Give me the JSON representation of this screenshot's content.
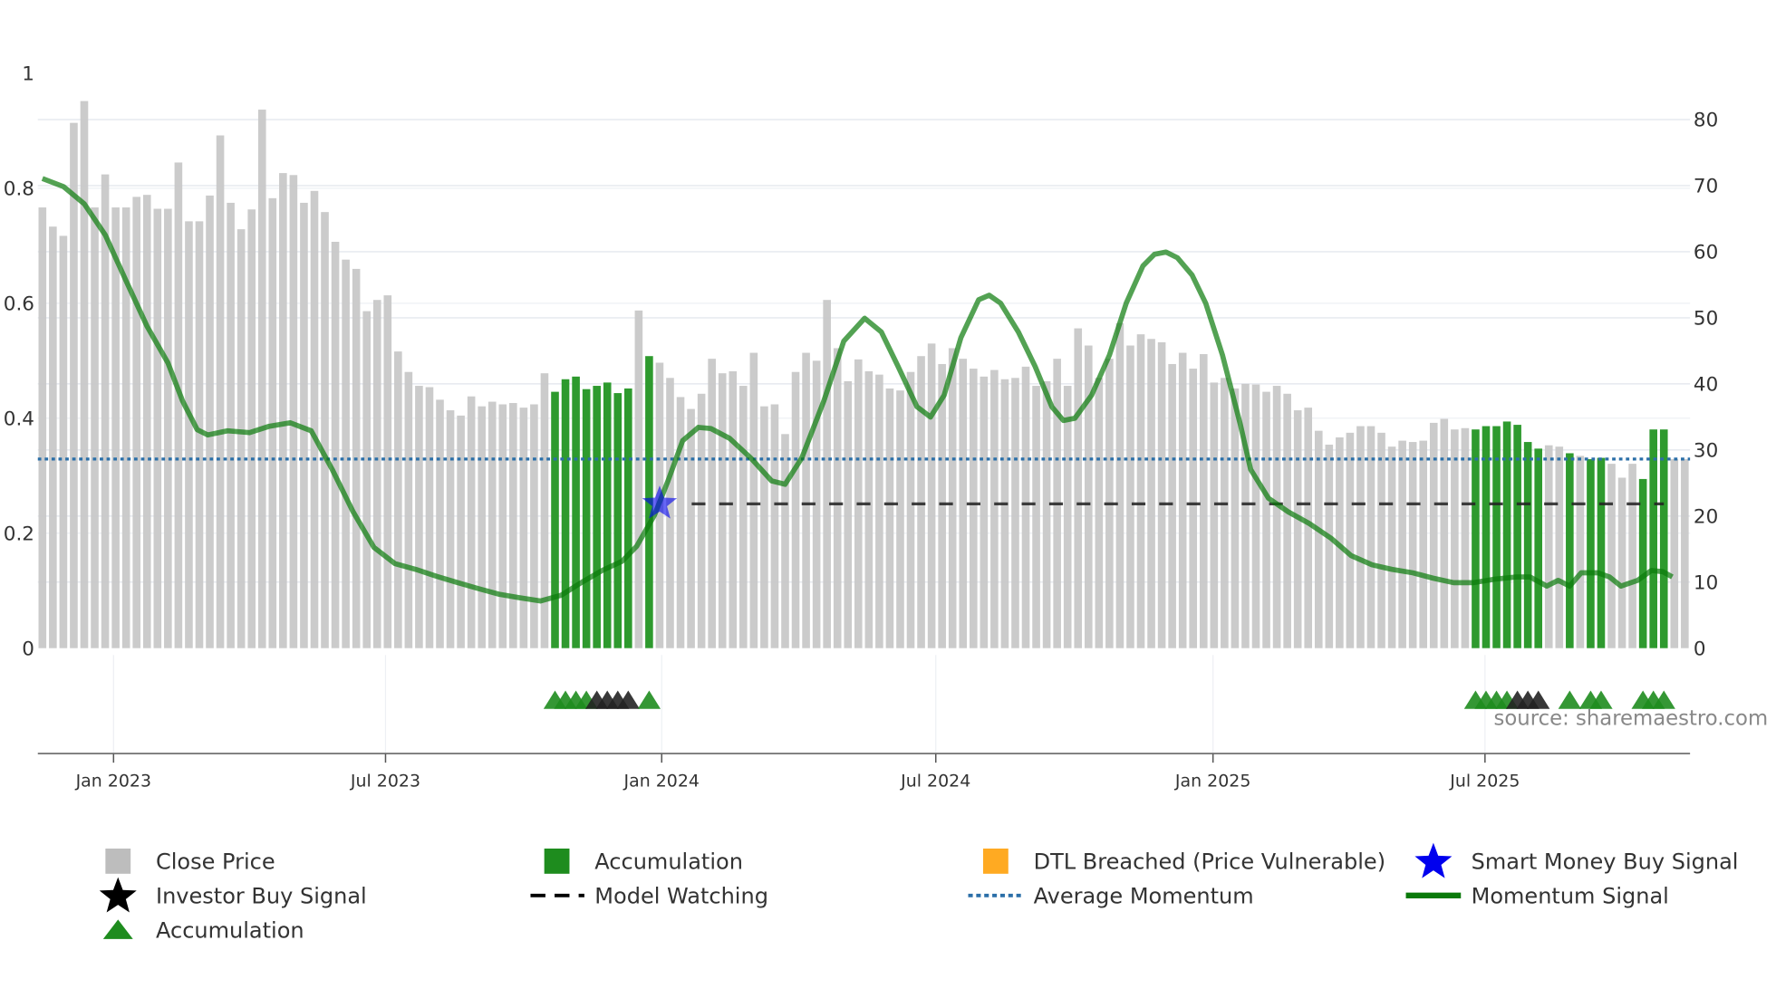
{
  "chart_data": {
    "type": "bar",
    "title": "",
    "source": "source: sharemaestro.com",
    "colors": {
      "close": "#c8c8c8",
      "accumulation": "#2e9a2e",
      "dtl": "#ffaa22",
      "smart_money": "#0000ee",
      "investor": "#000000",
      "model_watching": "#222222",
      "avg_momentum": "#2b6fa8",
      "momentum": "#0a7a0a",
      "triangle_green": "#1e8c1e",
      "triangle_black": "#222222"
    },
    "left_axis": {
      "ylim": [
        0,
        1
      ],
      "ticks": [
        "0",
        "0.2",
        "0.4",
        "0.6",
        "0.8",
        "1"
      ],
      "tick_values": [
        0,
        0.2,
        0.4,
        0.6,
        0.8,
        1
      ]
    },
    "right_axis": {
      "ylim": [
        0,
        87
      ],
      "ticks": [
        "0",
        "10",
        "20",
        "30",
        "40",
        "50",
        "60",
        "70",
        "80"
      ],
      "tick_values": [
        0,
        10,
        20,
        30,
        40,
        50,
        60,
        70,
        80
      ]
    },
    "x_ticks": [
      {
        "label": "Jan 2023",
        "week": 6.8
      },
      {
        "label": "Jul 2023",
        "week": 32.8
      },
      {
        "label": "Jan 2024",
        "week": 59.2
      },
      {
        "label": "Jul 2024",
        "week": 85.4
      },
      {
        "label": "Jan 2025",
        "week": 111.9
      },
      {
        "label": "Jul 2025",
        "week": 137.9
      }
    ],
    "close_price": [
      66.7,
      63.8,
      62.4,
      79.5,
      82.8,
      66.7,
      71.7,
      66.7,
      66.7,
      68.3,
      68.6,
      66.5,
      66.5,
      73.5,
      64.6,
      64.6,
      68.5,
      77.6,
      67.4,
      63.4,
      66.4,
      81.5,
      68.1,
      71.9,
      71.6,
      67.4,
      69.2,
      66.0,
      61.5,
      58.8,
      57.4,
      51.0,
      52.7,
      53.4,
      44.9,
      41.8,
      39.7,
      39.5,
      37.6,
      36.0,
      35.2,
      38.1,
      36.6,
      37.3,
      36.9,
      37.1,
      36.4,
      36.9,
      41.6,
      38.8,
      40.7,
      41.1,
      39.2,
      39.7,
      40.2,
      38.6,
      39.3,
      51.1,
      44.2,
      43.2,
      40.9,
      38.0,
      36.2,
      38.5,
      43.8,
      41.6,
      41.9,
      39.7,
      44.7,
      36.6,
      36.9,
      32.4,
      41.8,
      44.7,
      43.5,
      52.7,
      45.4,
      40.4,
      43.7,
      41.9,
      41.4,
      39.3,
      39.0,
      41.8,
      44.2,
      46.1,
      43.0,
      45.4,
      43.8,
      42.3,
      41.1,
      42.1,
      40.7,
      40.9,
      42.6,
      39.7,
      40.4,
      43.8,
      39.7,
      48.4,
      45.8,
      40.9,
      43.8,
      49.2,
      45.8,
      47.5,
      46.8,
      46.3,
      43.0,
      44.7,
      42.3,
      44.5,
      40.2,
      40.9,
      39.3,
      40.0,
      39.9,
      38.8,
      39.7,
      38.5,
      36.0,
      36.4,
      32.9,
      30.8,
      31.9,
      32.6,
      33.6,
      33.6,
      32.6,
      30.5,
      31.4,
      31.2,
      31.4,
      34.1,
      34.7,
      33.1,
      33.3,
      33.1,
      33.6,
      33.6,
      34.3,
      33.8,
      31.2,
      30.2,
      30.7,
      30.5,
      29.5,
      29.1,
      28.6,
      28.8,
      27.9,
      25.8,
      27.9,
      25.6,
      33.1,
      33.1,
      28.6,
      28.6
    ],
    "accumulation_weeks": [
      49,
      50,
      51,
      52,
      53,
      54,
      55,
      56,
      58,
      137,
      138,
      139,
      140,
      141,
      142,
      143,
      146,
      148,
      149,
      153,
      154,
      155
    ],
    "momentum": [
      [
        0,
        0.817
      ],
      [
        2,
        0.803
      ],
      [
        4,
        0.773
      ],
      [
        6,
        0.719
      ],
      [
        8,
        0.639
      ],
      [
        10,
        0.56
      ],
      [
        12,
        0.496
      ],
      [
        13.4,
        0.43
      ],
      [
        14.8,
        0.38
      ],
      [
        15.8,
        0.371
      ],
      [
        17.7,
        0.378
      ],
      [
        19.8,
        0.375
      ],
      [
        21.7,
        0.386
      ],
      [
        23.7,
        0.392
      ],
      [
        25.7,
        0.378
      ],
      [
        27.7,
        0.311
      ],
      [
        29.7,
        0.237
      ],
      [
        31.7,
        0.175
      ],
      [
        33.7,
        0.147
      ],
      [
        35.7,
        0.137
      ],
      [
        37.7,
        0.125
      ],
      [
        39.7,
        0.114
      ],
      [
        41.6,
        0.104
      ],
      [
        43.6,
        0.094
      ],
      [
        45.5,
        0.088
      ],
      [
        47.6,
        0.082
      ],
      [
        49.6,
        0.092
      ],
      [
        51.5,
        0.114
      ],
      [
        53.5,
        0.135
      ],
      [
        55.4,
        0.151
      ],
      [
        56.8,
        0.177
      ],
      [
        58.5,
        0.231
      ],
      [
        59.8,
        0.291
      ],
      [
        61.2,
        0.361
      ],
      [
        62.7,
        0.384
      ],
      [
        63.9,
        0.382
      ],
      [
        65.7,
        0.365
      ],
      [
        67.7,
        0.331
      ],
      [
        69.7,
        0.291
      ],
      [
        71,
        0.285
      ],
      [
        72.6,
        0.331
      ],
      [
        74.7,
        0.43
      ],
      [
        76.6,
        0.534
      ],
      [
        78.6,
        0.574
      ],
      [
        80.2,
        0.55
      ],
      [
        81.8,
        0.49
      ],
      [
        83.6,
        0.42
      ],
      [
        84.9,
        0.402
      ],
      [
        86.2,
        0.44
      ],
      [
        87.8,
        0.54
      ],
      [
        89.5,
        0.606
      ],
      [
        90.5,
        0.614
      ],
      [
        91.6,
        0.6
      ],
      [
        93.3,
        0.55
      ],
      [
        94.9,
        0.49
      ],
      [
        96.5,
        0.42
      ],
      [
        97.6,
        0.396
      ],
      [
        98.7,
        0.4
      ],
      [
        100.3,
        0.44
      ],
      [
        102,
        0.51
      ],
      [
        103.6,
        0.6
      ],
      [
        105.2,
        0.665
      ],
      [
        106.3,
        0.685
      ],
      [
        107.4,
        0.689
      ],
      [
        108.5,
        0.679
      ],
      [
        109.9,
        0.649
      ],
      [
        111.2,
        0.6
      ],
      [
        112.8,
        0.51
      ],
      [
        114.5,
        0.39
      ],
      [
        115.5,
        0.311
      ],
      [
        117.2,
        0.261
      ],
      [
        119.1,
        0.237
      ],
      [
        121.1,
        0.217
      ],
      [
        123.2,
        0.191
      ],
      [
        125.1,
        0.161
      ],
      [
        127.1,
        0.145
      ],
      [
        129,
        0.137
      ],
      [
        131,
        0.131
      ],
      [
        132.9,
        0.122
      ],
      [
        134.9,
        0.114
      ],
      [
        136.8,
        0.114
      ],
      [
        138.8,
        0.12
      ],
      [
        140.9,
        0.124
      ],
      [
        142.2,
        0.124
      ],
      [
        143.8,
        0.108
      ],
      [
        144.9,
        0.118
      ],
      [
        146,
        0.108
      ],
      [
        147.1,
        0.131
      ],
      [
        148.7,
        0.131
      ],
      [
        149.8,
        0.124
      ],
      [
        150.9,
        0.108
      ],
      [
        152.5,
        0.118
      ],
      [
        153.8,
        0.135
      ],
      [
        154.9,
        0.133
      ],
      [
        155.8,
        0.124
      ]
    ],
    "average_momentum": 0.329,
    "model_watching": {
      "value": 0.251,
      "from_week": 59,
      "to_week": 155
    },
    "smart_money_signal": {
      "week": 59,
      "value": 0.251
    },
    "triangles": [
      {
        "week": 49,
        "kind": "green"
      },
      {
        "week": 50,
        "kind": "green"
      },
      {
        "week": 51,
        "kind": "green"
      },
      {
        "week": 52,
        "kind": "green"
      },
      {
        "week": 53,
        "kind": "black"
      },
      {
        "week": 54,
        "kind": "black"
      },
      {
        "week": 55,
        "kind": "black"
      },
      {
        "week": 56,
        "kind": "black"
      },
      {
        "week": 58,
        "kind": "green"
      },
      {
        "week": 137,
        "kind": "green"
      },
      {
        "week": 138,
        "kind": "green"
      },
      {
        "week": 139,
        "kind": "green"
      },
      {
        "week": 140,
        "kind": "green"
      },
      {
        "week": 141,
        "kind": "black"
      },
      {
        "week": 142,
        "kind": "black"
      },
      {
        "week": 143,
        "kind": "black"
      },
      {
        "week": 146,
        "kind": "green"
      },
      {
        "week": 148,
        "kind": "green"
      },
      {
        "week": 149,
        "kind": "green"
      },
      {
        "week": 153,
        "kind": "green"
      },
      {
        "week": 154,
        "kind": "green"
      },
      {
        "week": 155,
        "kind": "green"
      }
    ],
    "legend": [
      {
        "label": "Close Price",
        "symbol": "square",
        "color": "#bdbdbd"
      },
      {
        "label": "Accumulation",
        "symbol": "square",
        "color": "#1e8c1e"
      },
      {
        "label": "DTL Breached (Price Vulnerable)",
        "symbol": "square",
        "color": "#ffaa22"
      },
      {
        "label": "Smart Money Buy Signal",
        "symbol": "star",
        "color": "#0000ee"
      },
      {
        "label": "Investor Buy Signal",
        "symbol": "star",
        "color": "#000000"
      },
      {
        "label": "Model Watching",
        "symbol": "dash",
        "color": "#000000"
      },
      {
        "label": "Average Momentum",
        "symbol": "dot",
        "color": "#2b6fa8"
      },
      {
        "label": "Momentum Signal",
        "symbol": "line",
        "color": "#0a7a0a"
      },
      {
        "label": "Accumulation",
        "symbol": "triangle",
        "color": "#1e8c1e"
      }
    ],
    "legend_placement": "bottom"
  }
}
